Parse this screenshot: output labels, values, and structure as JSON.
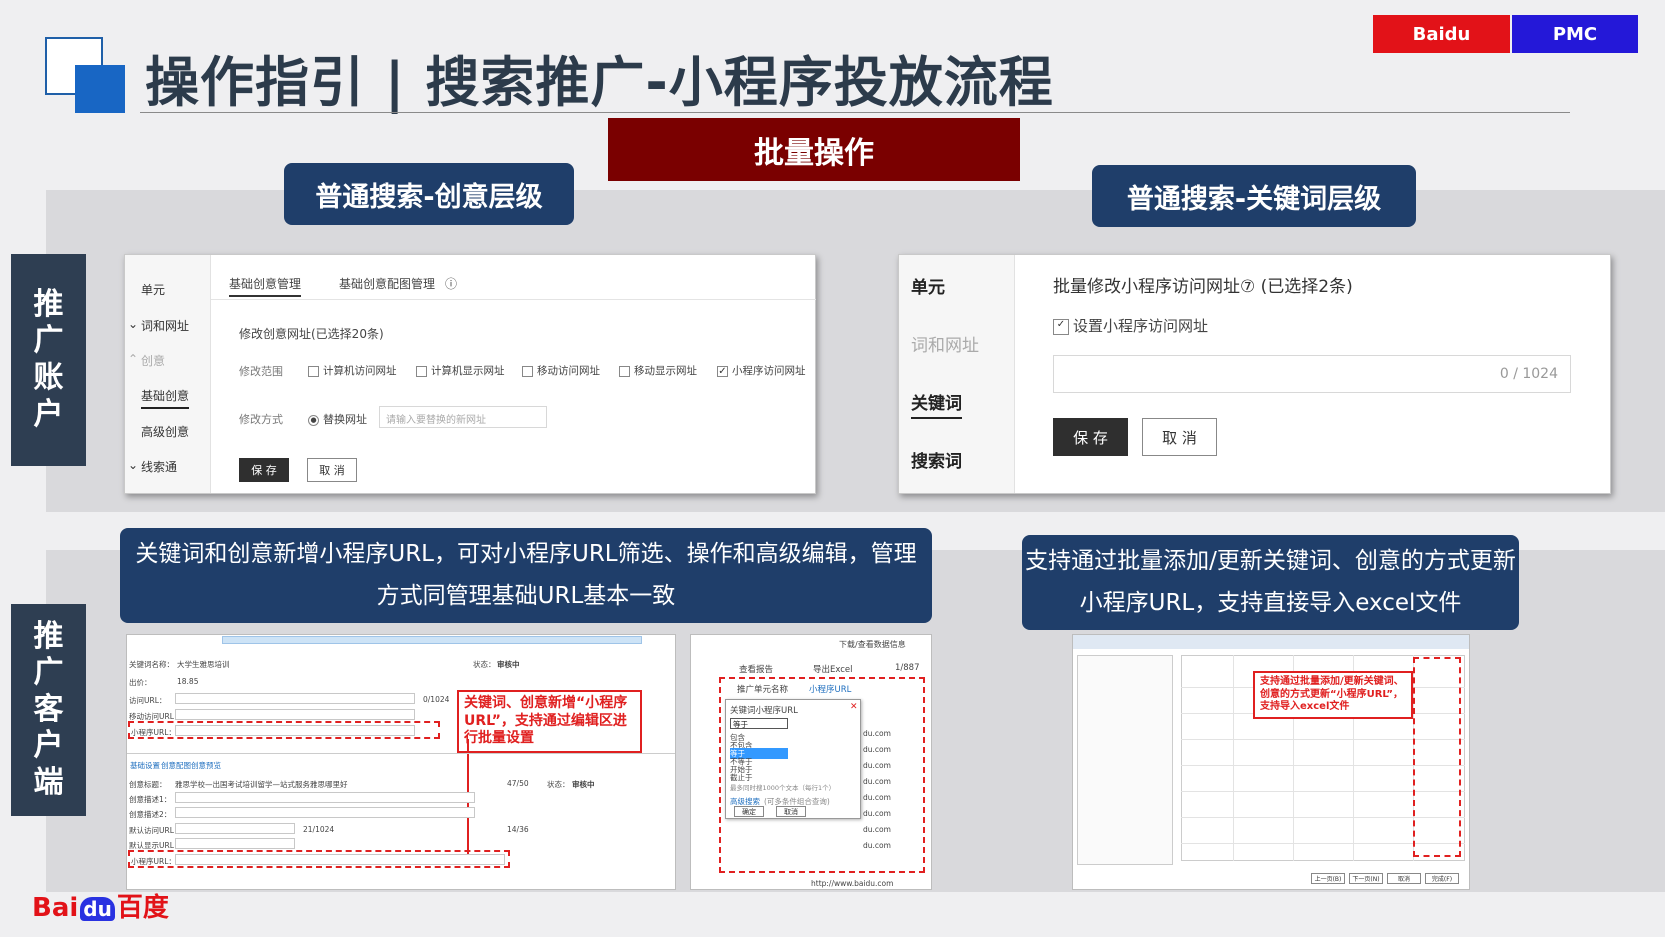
{
  "header": {
    "title": "操作指引 | 搜索推广-小程序投放流程",
    "tag_baidu": "Baidu",
    "tag_pmc": "PMC",
    "banner": "批量操作"
  },
  "sections": {
    "creative_level": "普通搜索-创意层级",
    "keyword_level": "普通搜索-关键词层级",
    "account_label": [
      "推",
      "广",
      "账",
      "户"
    ],
    "client_label": [
      "推",
      "广",
      "客",
      "户",
      "端"
    ]
  },
  "creative_window": {
    "sidebar": [
      "单元",
      "词和网址",
      "创意",
      "基础创意",
      "高级创意",
      "线索通"
    ],
    "tabs": [
      "基础创意管理",
      "基础创意配图管理"
    ],
    "heading": "修改创意网址(已选择20条)",
    "range_label": "修改范围",
    "range_options": [
      "计算机访问网址",
      "计算机显示网址",
      "移动访问网址",
      "移动显示网址",
      "小程序访问网址"
    ],
    "mode_label": "修改方式",
    "mode_option": "替换网址",
    "input_placeholder": "请输入要替换的新网址",
    "save": "保 存",
    "cancel": "取 消"
  },
  "keyword_window": {
    "sidebar": [
      "单元",
      "词和网址",
      "关键词",
      "搜索词"
    ],
    "heading": "批量修改小程序访问网址⑦ (已选择2条)",
    "checkbox_label": "设置小程序访问网址",
    "counter": "0 / 1024",
    "save": "保 存",
    "cancel": "取 消"
  },
  "notes": {
    "left": "关键词和创意新增小程序URL，可对小程序URL筛选、操作和高级编辑，管理方式同管理基础URL基本一致",
    "right": "支持通过批量添加/更新关键词、创意的方式更新小程序URL，支持直接导入excel文件"
  },
  "shot1": {
    "rows": [
      "关键词名称：",
      "出价：",
      "访问URL：",
      "移动访问URL：",
      "小程序URL："
    ],
    "keyword_value": "大学生雅思培训",
    "bid_value": "18.85",
    "status_label": "状态：",
    "status_value": "审核中",
    "tabs": [
      "基础设置",
      "创意配图",
      "创意预览"
    ],
    "creative_rows": [
      "创意标题：",
      "创意描述1：",
      "创意描述2：",
      "默认访问URL：",
      "默认显示URL：",
      "小程序URL："
    ],
    "creative_title_value": "雅思学校—出国考试培训留学—站式服务雅思哪里好",
    "callout": "关键词、创意新增“小程序URL”，支持通过编辑区进行批量设置",
    "counts": [
      "0/1024",
      "47/50",
      "21/1024",
      "14/36"
    ]
  },
  "shot2": {
    "toolbar": [
      "下载/查看数据信息",
      "查看报告",
      "导出Excel",
      "1/887"
    ],
    "columns": [
      "推广单元名称",
      "小程序URL"
    ],
    "filter_title": "关键词小程序URL",
    "select_value": "等于",
    "options": [
      "包含",
      "不包含",
      "等于",
      "不等于",
      "开始于",
      "截止于"
    ],
    "hint": "最多同时搜1000个文本（每行1个）",
    "advanced": "高级搜索",
    "advanced_hint": "(可多条件组合查询)",
    "ok": "确定",
    "cancel": "取消",
    "url_suffix": "du.com",
    "footer_url": "http://www.baidu.com"
  },
  "shot3": {
    "callout": "支持通过批量添加/更新关键词、创意的方式更新“小程序URL”，支持导入excel文件",
    "buttons": [
      "上一页(B)",
      "下一页(N)",
      "取消",
      "完成(F)"
    ]
  },
  "footer": {
    "bai": "Bai",
    "du": "du",
    "name": "百度"
  }
}
